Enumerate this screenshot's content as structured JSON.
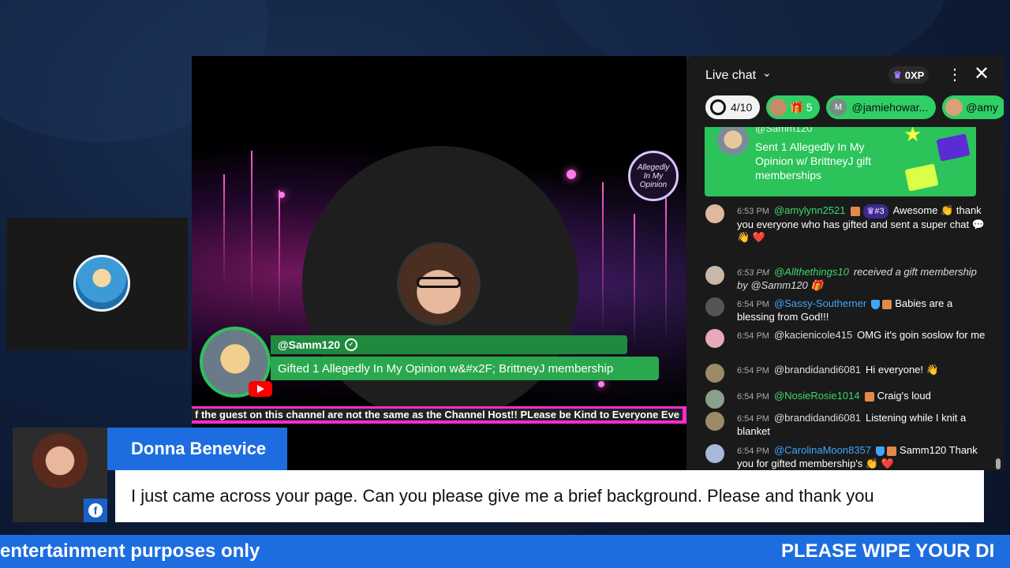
{
  "guest_tile": {
    "avatar_alt": "guest avatar"
  },
  "stage": {
    "logo_text": "Allegedly In My Opinion",
    "alert": {
      "username": "@Samm120",
      "message": "Gifted 1 Allegedly In My Opinion w&#x2F; BrittneyJ membership"
    },
    "ticker_text": "f the guest on this channel are not the same as the Channel Host!! PLease be Kind to Everyone Eve"
  },
  "chat": {
    "title": "Live chat",
    "xp_label": "0XP",
    "chips": {
      "goal": "4/10",
      "gift_count": "5",
      "user1": "@jamiehowar...",
      "user2": "@amy"
    },
    "gift_card": {
      "username": "@Samm120",
      "text": "Sent 1 Allegedly In My Opinion w/ BrittneyJ gift memberships"
    },
    "messages": [
      {
        "time": "6:53 PM",
        "author": "@amylynn2521",
        "rank": "#3",
        "text": "Awesome 👏 thank you everyone who has gifted and sent a super chat 💬 👋 ❤️"
      },
      {
        "time": "6:53 PM",
        "author": "@Allthethings10",
        "text": "received a gift membership by @Samm120 🎁"
      },
      {
        "time": "6:54 PM",
        "author": "@Sassy-Southerner",
        "text": "Babies are a blessing from God!!!"
      },
      {
        "time": "6:54 PM",
        "author": "@kacienicole415",
        "text": "OMG it's goin soslow for me"
      },
      {
        "time": "6:54 PM",
        "author": "@brandidandi6081",
        "text": "Hi everyone! 👋"
      },
      {
        "time": "6:54 PM",
        "author": "@NosieRosie1014",
        "text": "Craig's loud"
      },
      {
        "time": "6:54 PM",
        "author": "@brandidandi6081",
        "text": "Listening while I knit a blanket"
      },
      {
        "time": "6:54 PM",
        "author": "@CarolinaMoon8357",
        "text": "Samm120 Thank you for gifted membership's 👏 ❤️"
      }
    ]
  },
  "caption": {
    "name": "Donna Benevice",
    "text": "I just came across your page. Can you please give me a brief background. Please and thank you"
  },
  "ticker": {
    "left": "entertainment purposes only",
    "right": "PLEASE WIPE YOUR DI"
  },
  "colors": {
    "accent_blue": "#1d6de0",
    "chat_green": "#2bc35a",
    "stage_pink": "#ff2bd0"
  }
}
